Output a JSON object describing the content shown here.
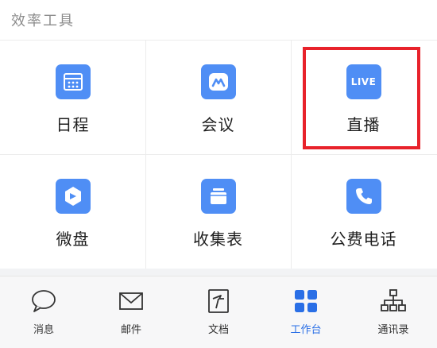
{
  "section": {
    "title": "效率工具"
  },
  "tools": [
    {
      "label": "日程",
      "icon": "calendar-icon"
    },
    {
      "label": "会议",
      "icon": "meeting-icon"
    },
    {
      "label": "直播",
      "icon": "live-icon",
      "badge": "LIVE"
    },
    {
      "label": "微盘",
      "icon": "drive-icon"
    },
    {
      "label": "收集表",
      "icon": "form-collect-icon"
    },
    {
      "label": "公费电话",
      "icon": "phone-icon"
    }
  ],
  "tabbar": [
    {
      "label": "消息",
      "icon": "message-icon"
    },
    {
      "label": "邮件",
      "icon": "mail-icon"
    },
    {
      "label": "文档",
      "icon": "document-icon"
    },
    {
      "label": "工作台",
      "icon": "workbench-icon",
      "active": true
    },
    {
      "label": "通讯录",
      "icon": "contacts-icon"
    }
  ],
  "colors": {
    "accent": "#2a6fe6",
    "tile": "#4f8ef5",
    "highlight": "#e8222b"
  }
}
